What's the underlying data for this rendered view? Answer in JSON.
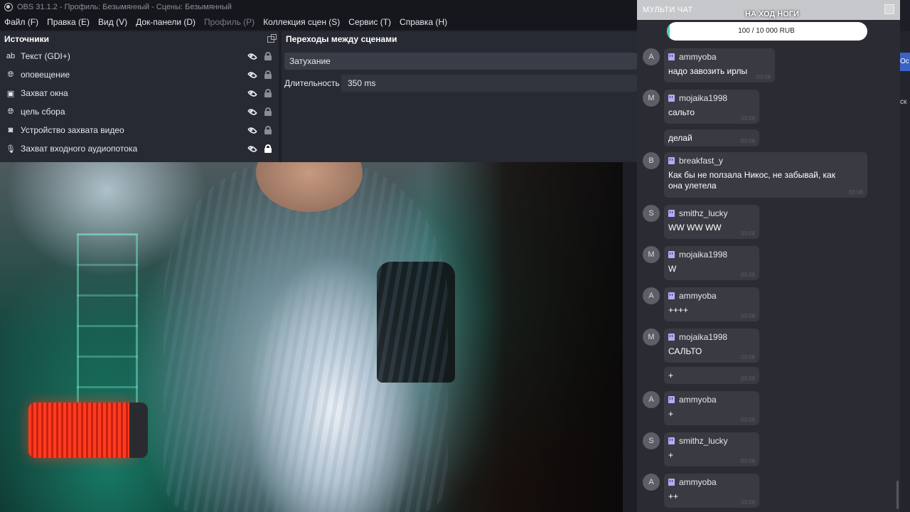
{
  "window": {
    "title": "OBS 31.1.2 - Профиль: Безымянный - Сцены: Безымянный"
  },
  "menu": [
    {
      "label": "Файл (F)",
      "disabled": false
    },
    {
      "label": "Правка (E)",
      "disabled": false
    },
    {
      "label": "Вид (V)",
      "disabled": false
    },
    {
      "label": "Док-панели (D)",
      "disabled": false
    },
    {
      "label": "Профиль (P)",
      "disabled": true
    },
    {
      "label": "Коллекция сцен (S)",
      "disabled": false
    },
    {
      "label": "Сервис (T)",
      "disabled": false
    },
    {
      "label": "Справка (H)",
      "disabled": false
    }
  ],
  "sources": {
    "title": "Источники",
    "items": [
      {
        "label": "Текст (GDI+)",
        "icon": "text-icon",
        "locked": false
      },
      {
        "label": "оповещение",
        "icon": "globe-icon",
        "locked": false
      },
      {
        "label": "Захват окна",
        "icon": "window-icon",
        "locked": false
      },
      {
        "label": "цель сбора",
        "icon": "globe-icon",
        "locked": false
      },
      {
        "label": "Устройство захвата видео",
        "icon": "camera-icon",
        "locked": false
      },
      {
        "label": "Захват входного аудиопотока",
        "icon": "microphone-icon",
        "locked": true
      }
    ]
  },
  "transitions": {
    "title": "Переходы между сценами",
    "selected": "Затухание",
    "duration_label": "Длительность",
    "duration_value": "350 ms"
  },
  "right_strip": {
    "button_fragment": "Ос",
    "text_fragment": "ск"
  },
  "chat": {
    "title": "МУЛЬТИ ЧАТ",
    "goal": {
      "title": "НА ХОД НОГИ",
      "text": "100 / 10 000 RUB",
      "progress": 0.01
    },
    "messages": [
      {
        "avatar": "A",
        "user": "ammyoba",
        "lines": [
          {
            "text": "надо завозить ирлы",
            "time": "03:08"
          }
        ]
      },
      {
        "avatar": "M",
        "user": "mojaika1998",
        "lines": [
          {
            "text": "сальто",
            "time": "03:08"
          },
          {
            "text": "делай",
            "time": "03:08"
          }
        ]
      },
      {
        "avatar": "B",
        "user": "breakfast_y",
        "lines": [
          {
            "text": "Как бы не ползала Никос, не забывай, как она улетела",
            "time": "03:08"
          }
        ]
      },
      {
        "avatar": "S",
        "user": "smithz_lucky",
        "lines": [
          {
            "text": "WW WW WW",
            "time": "03:08"
          }
        ]
      },
      {
        "avatar": "M",
        "user": "mojaika1998",
        "lines": [
          {
            "text": "W",
            "time": "03:08"
          }
        ]
      },
      {
        "avatar": "A",
        "user": "ammyoba",
        "lines": [
          {
            "text": "++++",
            "time": "03:08"
          }
        ]
      },
      {
        "avatar": "M",
        "user": "mojaika1998",
        "lines": [
          {
            "text": "САЛЬТО",
            "time": "03:08"
          },
          {
            "text": "+",
            "time": "03:08"
          }
        ]
      },
      {
        "avatar": "A",
        "user": "ammyoba",
        "lines": [
          {
            "text": "+",
            "time": "03:08"
          }
        ]
      },
      {
        "avatar": "S",
        "user": "smithz_lucky",
        "lines": [
          {
            "text": "+",
            "time": "03:08"
          }
        ]
      },
      {
        "avatar": "A",
        "user": "ammyoba",
        "lines": [
          {
            "text": "++",
            "time": "03:08"
          }
        ]
      }
    ]
  }
}
